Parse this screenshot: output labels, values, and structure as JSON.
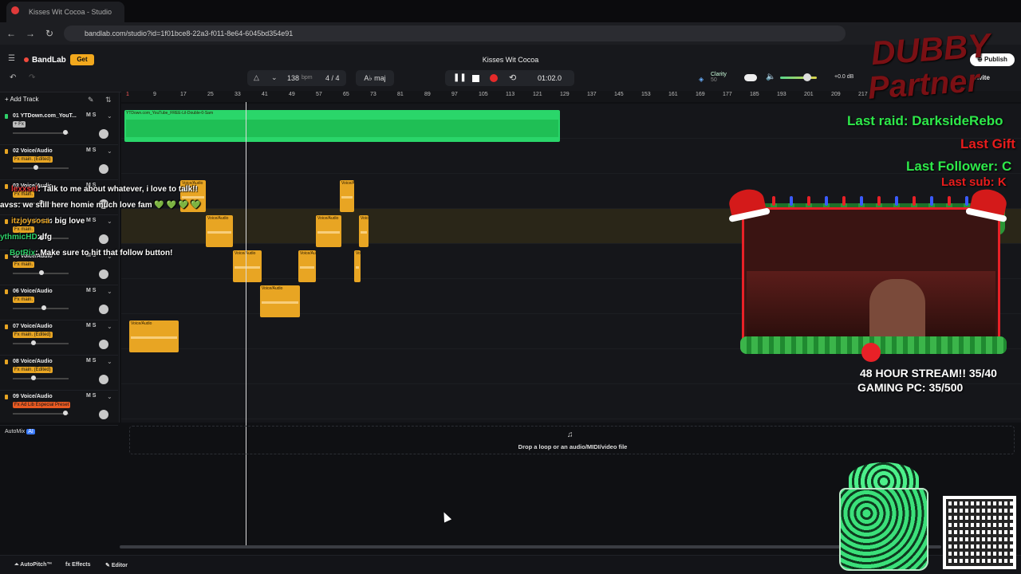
{
  "browser": {
    "tab_title": "Kisses Wit Cocoa - Studio",
    "url": "bandlab.com/studio?id=1f01bce8-22a3-f011-8e64-6045bd354e91"
  },
  "header": {
    "logo": "BandLab",
    "get_label": "Get",
    "song_title": "Kisses Wit Cocoa",
    "publish_label": "Publish",
    "invite_label": "Invite",
    "bpm": "138",
    "bpm_unit": "bpm",
    "time_signature": "4 / 4",
    "key": "maj",
    "time": "01:02.0",
    "clarity_label": "Clarity",
    "clarity_value": "50",
    "db": "+0.0 dB"
  },
  "ruler": [
    "1",
    "9",
    "17",
    "25",
    "33",
    "41",
    "49",
    "57",
    "65",
    "73",
    "81",
    "89",
    "97",
    "105",
    "113",
    "121",
    "129",
    "137",
    "145",
    "153",
    "161",
    "169",
    "177",
    "185",
    "193",
    "201",
    "209",
    "217"
  ],
  "sidebar": {
    "add_track_label": "Add Track",
    "automix_label": "AutoMix",
    "automix_badge": "AI",
    "tracks": [
      {
        "name": "01  YTDown.com_YouT...",
        "fx": "+ Fx",
        "color": "#2fd06a",
        "fx_color": "#bbbbbb",
        "volume": 0.95,
        "ms": "M  S"
      },
      {
        "name": "02  Voice/Audio",
        "fx": "Fx main. (Edited)",
        "color": "#e8a523",
        "fx_color": "#e8a523",
        "volume": 0.4,
        "ms": "M  S"
      },
      {
        "name": "03  Voice/Audio",
        "fx": "Fx main.",
        "color": "#e8a523",
        "fx_color": "#e8a523",
        "volume": 0.5,
        "ms": "M  S"
      },
      {
        "name": "04  Voice/Audio",
        "fx": "Fx main.",
        "color": "#e8a523",
        "fx_color": "#e8a523",
        "volume": 0.5,
        "ms": "M  S"
      },
      {
        "name": "05  Voice/Audio",
        "fx": "Fx main.",
        "color": "#e8a523",
        "fx_color": "#e8a523",
        "volume": 0.5,
        "ms": "M  S"
      },
      {
        "name": "06  Voice/Audio",
        "fx": "Fx main.",
        "color": "#e8a523",
        "fx_color": "#e8a523",
        "volume": 0.55,
        "ms": "M  S"
      },
      {
        "name": "07  Voice/Audio",
        "fx": "Fx main. (Edited)",
        "color": "#e8a523",
        "fx_color": "#e8a523",
        "volume": 0.35,
        "ms": "M  S"
      },
      {
        "name": "08  Voice/Audio",
        "fx": "Fx main. (Edited)",
        "color": "#e8a523",
        "fx_color": "#e8a523",
        "volume": 0.35,
        "ms": "M  S"
      },
      {
        "name": "09  Voice/Audio",
        "fx": "Fx Ad Lib Especial Preset",
        "color": "#e8a523",
        "fx_color": "#e85a23",
        "volume": 0.95,
        "ms": "M  S"
      }
    ]
  },
  "clips": {
    "beat_label": "YTDown.com_YouTube_FREE-Lil-Double-0-Sam",
    "voice_label": "Voice/Audio"
  },
  "drop_zone": {
    "text": "Drop a loop or an audio/MIDI/video file"
  },
  "footer": {
    "autopitch": "AutoPitch™",
    "effects": "Effects",
    "editor": "Editor"
  },
  "overlay": {
    "chat": [
      {
        "user": "lexxsel",
        "message": ": Talk to me about whatever, i love to talk!!",
        "user_color": "#e83a3a"
      },
      {
        "user": "avss",
        "message": ": we still here homie much love fam 💚 💚 💚 💚",
        "user_color": "#ffffff"
      },
      {
        "user": "itzjoysosa",
        "message": ": big love",
        "user_color": "#e8a523"
      },
      {
        "user": "ythmicHD",
        "message": ": lfg",
        "user_color": "#2fd06a"
      },
      {
        "user": "BotRix",
        "message": ": Make sure to hit that follow button!",
        "user_color": "#2fd06a"
      }
    ],
    "last_raid": "Last raid: DarksideRebo",
    "last_gift": "Last Gift",
    "last_follower": "Last Follower: C",
    "last_sub": "Last sub: K",
    "stream_goal": "48 HOUR STREAM!! 35/40",
    "pc_goal": "GAMING PC: 35/500",
    "watermark_line1": "DUBBY",
    "watermark_line2": "Partner"
  }
}
